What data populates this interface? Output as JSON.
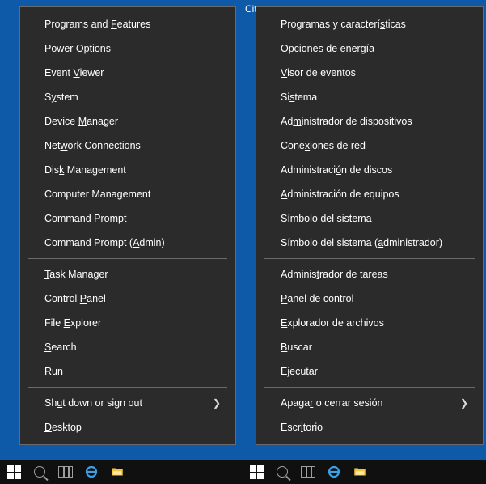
{
  "background_tab_left": "Cit",
  "menu_left": {
    "section1": [
      {
        "pre": "Programs and ",
        "u": "F",
        "post": "eatures"
      },
      {
        "pre": "Power ",
        "u": "O",
        "post": "ptions"
      },
      {
        "pre": "Event ",
        "u": "V",
        "post": "iewer"
      },
      {
        "pre": "S",
        "u": "y",
        "post": "stem"
      },
      {
        "pre": "Device ",
        "u": "M",
        "post": "anager"
      },
      {
        "pre": "Net",
        "u": "w",
        "post": "ork Connections"
      },
      {
        "pre": "Dis",
        "u": "k",
        "post": " Management"
      },
      {
        "pre": "Computer Mana",
        "u": "g",
        "post": "ement"
      },
      {
        "pre": "",
        "u": "C",
        "post": "ommand Prompt"
      },
      {
        "pre": "Command Prompt (",
        "u": "A",
        "post": "dmin)"
      }
    ],
    "section2": [
      {
        "pre": "",
        "u": "T",
        "post": "ask Manager"
      },
      {
        "pre": "Control ",
        "u": "P",
        "post": "anel"
      },
      {
        "pre": "File ",
        "u": "E",
        "post": "xplorer"
      },
      {
        "pre": "",
        "u": "S",
        "post": "earch"
      },
      {
        "pre": "",
        "u": "R",
        "post": "un"
      }
    ],
    "section3": [
      {
        "pre": "Sh",
        "u": "u",
        "post": "t down or sign out",
        "submenu": true
      },
      {
        "pre": "",
        "u": "D",
        "post": "esktop"
      }
    ]
  },
  "menu_right": {
    "section1": [
      {
        "pre": "Programas y caracterí",
        "u": "s",
        "post": "ticas"
      },
      {
        "pre": "",
        "u": "O",
        "post": "pciones de energía"
      },
      {
        "pre": "",
        "u": "V",
        "post": "isor de eventos"
      },
      {
        "pre": "Si",
        "u": "s",
        "post": "tema"
      },
      {
        "pre": "Ad",
        "u": "m",
        "post": "inistrador de dispositivos"
      },
      {
        "pre": "Cone",
        "u": "x",
        "post": "iones de red"
      },
      {
        "pre": "Administraci",
        "u": "ó",
        "post": "n de discos"
      },
      {
        "pre": "",
        "u": "A",
        "post": "dministración de equipos"
      },
      {
        "pre": "Símbolo del siste",
        "u": "m",
        "post": "a"
      },
      {
        "pre": "Símbolo del sistema (",
        "u": "a",
        "post": "dministrador)"
      }
    ],
    "section2": [
      {
        "pre": "Adminis",
        "u": "t",
        "post": "rador de tareas"
      },
      {
        "pre": "",
        "u": "P",
        "post": "anel de control"
      },
      {
        "pre": "",
        "u": "E",
        "post": "xplorador de archivos"
      },
      {
        "pre": "",
        "u": "B",
        "post": "uscar"
      },
      {
        "pre": "E",
        "u": "j",
        "post": "ecutar"
      }
    ],
    "section3": [
      {
        "pre": "Apaga",
        "u": "r",
        "post": " o cerrar sesión",
        "submenu": true
      },
      {
        "pre": "Escr",
        "u": "i",
        "post": "torio"
      }
    ]
  }
}
